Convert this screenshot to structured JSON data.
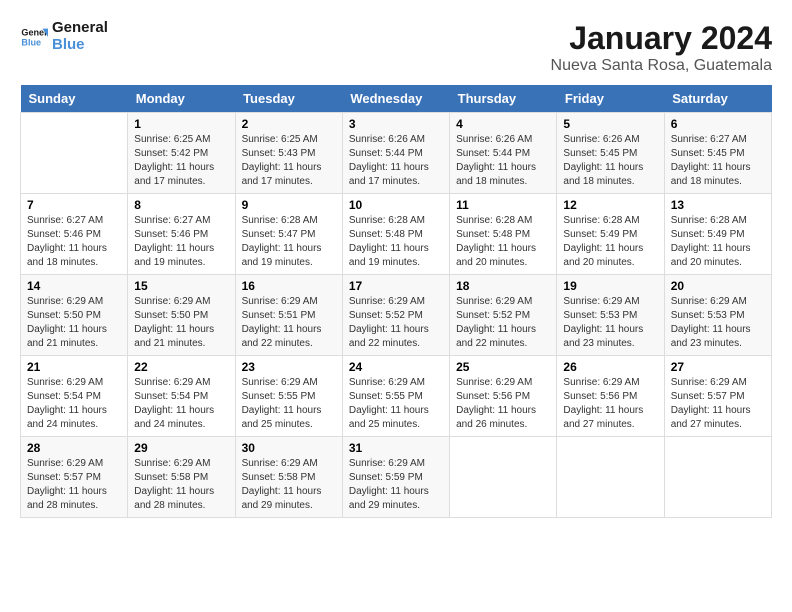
{
  "logo": {
    "text_general": "General",
    "text_blue": "Blue"
  },
  "header": {
    "title": "January 2024",
    "subtitle": "Nueva Santa Rosa, Guatemala"
  },
  "days_of_week": [
    "Sunday",
    "Monday",
    "Tuesday",
    "Wednesday",
    "Thursday",
    "Friday",
    "Saturday"
  ],
  "weeks": [
    [
      {
        "num": "",
        "info": ""
      },
      {
        "num": "1",
        "info": "Sunrise: 6:25 AM\nSunset: 5:42 PM\nDaylight: 11 hours\nand 17 minutes."
      },
      {
        "num": "2",
        "info": "Sunrise: 6:25 AM\nSunset: 5:43 PM\nDaylight: 11 hours\nand 17 minutes."
      },
      {
        "num": "3",
        "info": "Sunrise: 6:26 AM\nSunset: 5:44 PM\nDaylight: 11 hours\nand 17 minutes."
      },
      {
        "num": "4",
        "info": "Sunrise: 6:26 AM\nSunset: 5:44 PM\nDaylight: 11 hours\nand 18 minutes."
      },
      {
        "num": "5",
        "info": "Sunrise: 6:26 AM\nSunset: 5:45 PM\nDaylight: 11 hours\nand 18 minutes."
      },
      {
        "num": "6",
        "info": "Sunrise: 6:27 AM\nSunset: 5:45 PM\nDaylight: 11 hours\nand 18 minutes."
      }
    ],
    [
      {
        "num": "7",
        "info": "Sunrise: 6:27 AM\nSunset: 5:46 PM\nDaylight: 11 hours\nand 18 minutes."
      },
      {
        "num": "8",
        "info": "Sunrise: 6:27 AM\nSunset: 5:46 PM\nDaylight: 11 hours\nand 19 minutes."
      },
      {
        "num": "9",
        "info": "Sunrise: 6:28 AM\nSunset: 5:47 PM\nDaylight: 11 hours\nand 19 minutes."
      },
      {
        "num": "10",
        "info": "Sunrise: 6:28 AM\nSunset: 5:48 PM\nDaylight: 11 hours\nand 19 minutes."
      },
      {
        "num": "11",
        "info": "Sunrise: 6:28 AM\nSunset: 5:48 PM\nDaylight: 11 hours\nand 20 minutes."
      },
      {
        "num": "12",
        "info": "Sunrise: 6:28 AM\nSunset: 5:49 PM\nDaylight: 11 hours\nand 20 minutes."
      },
      {
        "num": "13",
        "info": "Sunrise: 6:28 AM\nSunset: 5:49 PM\nDaylight: 11 hours\nand 20 minutes."
      }
    ],
    [
      {
        "num": "14",
        "info": "Sunrise: 6:29 AM\nSunset: 5:50 PM\nDaylight: 11 hours\nand 21 minutes."
      },
      {
        "num": "15",
        "info": "Sunrise: 6:29 AM\nSunset: 5:50 PM\nDaylight: 11 hours\nand 21 minutes."
      },
      {
        "num": "16",
        "info": "Sunrise: 6:29 AM\nSunset: 5:51 PM\nDaylight: 11 hours\nand 22 minutes."
      },
      {
        "num": "17",
        "info": "Sunrise: 6:29 AM\nSunset: 5:52 PM\nDaylight: 11 hours\nand 22 minutes."
      },
      {
        "num": "18",
        "info": "Sunrise: 6:29 AM\nSunset: 5:52 PM\nDaylight: 11 hours\nand 22 minutes."
      },
      {
        "num": "19",
        "info": "Sunrise: 6:29 AM\nSunset: 5:53 PM\nDaylight: 11 hours\nand 23 minutes."
      },
      {
        "num": "20",
        "info": "Sunrise: 6:29 AM\nSunset: 5:53 PM\nDaylight: 11 hours\nand 23 minutes."
      }
    ],
    [
      {
        "num": "21",
        "info": "Sunrise: 6:29 AM\nSunset: 5:54 PM\nDaylight: 11 hours\nand 24 minutes."
      },
      {
        "num": "22",
        "info": "Sunrise: 6:29 AM\nSunset: 5:54 PM\nDaylight: 11 hours\nand 24 minutes."
      },
      {
        "num": "23",
        "info": "Sunrise: 6:29 AM\nSunset: 5:55 PM\nDaylight: 11 hours\nand 25 minutes."
      },
      {
        "num": "24",
        "info": "Sunrise: 6:29 AM\nSunset: 5:55 PM\nDaylight: 11 hours\nand 25 minutes."
      },
      {
        "num": "25",
        "info": "Sunrise: 6:29 AM\nSunset: 5:56 PM\nDaylight: 11 hours\nand 26 minutes."
      },
      {
        "num": "26",
        "info": "Sunrise: 6:29 AM\nSunset: 5:56 PM\nDaylight: 11 hours\nand 27 minutes."
      },
      {
        "num": "27",
        "info": "Sunrise: 6:29 AM\nSunset: 5:57 PM\nDaylight: 11 hours\nand 27 minutes."
      }
    ],
    [
      {
        "num": "28",
        "info": "Sunrise: 6:29 AM\nSunset: 5:57 PM\nDaylight: 11 hours\nand 28 minutes."
      },
      {
        "num": "29",
        "info": "Sunrise: 6:29 AM\nSunset: 5:58 PM\nDaylight: 11 hours\nand 28 minutes."
      },
      {
        "num": "30",
        "info": "Sunrise: 6:29 AM\nSunset: 5:58 PM\nDaylight: 11 hours\nand 29 minutes."
      },
      {
        "num": "31",
        "info": "Sunrise: 6:29 AM\nSunset: 5:59 PM\nDaylight: 11 hours\nand 29 minutes."
      },
      {
        "num": "",
        "info": ""
      },
      {
        "num": "",
        "info": ""
      },
      {
        "num": "",
        "info": ""
      }
    ]
  ]
}
